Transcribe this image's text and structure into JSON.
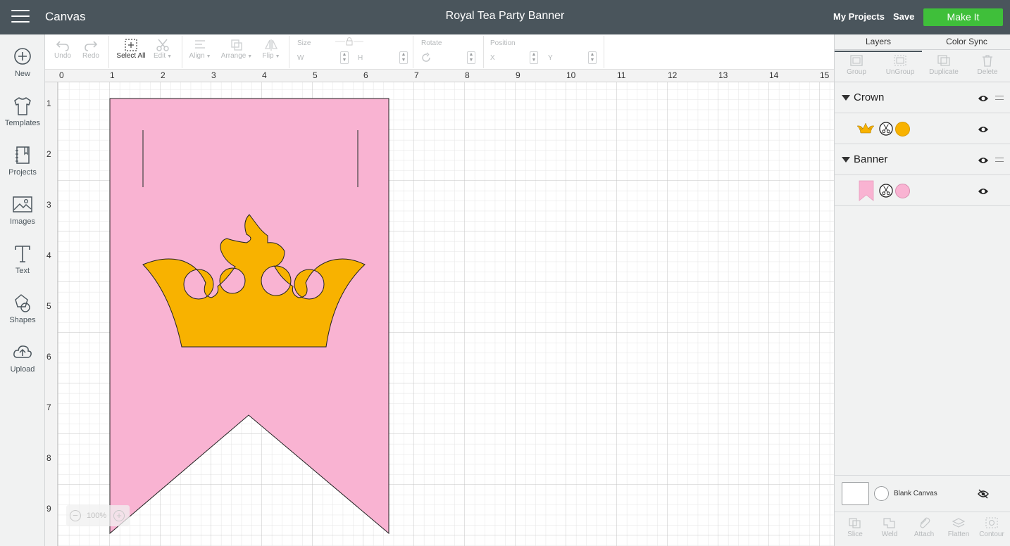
{
  "header": {
    "app_title": "Canvas",
    "doc_title": "Royal Tea Party Banner",
    "my_projects": "My Projects",
    "save": "Save",
    "make_it": "Make It",
    "make_it_color": "#3fbf3a",
    "bar_color": "#4a555c"
  },
  "sidebar": {
    "items": [
      {
        "label": "New",
        "icon": "plus-circle-icon"
      },
      {
        "label": "Templates",
        "icon": "tshirt-icon"
      },
      {
        "label": "Projects",
        "icon": "notebook-icon"
      },
      {
        "label": "Images",
        "icon": "image-icon"
      },
      {
        "label": "Text",
        "icon": "text-icon"
      },
      {
        "label": "Shapes",
        "icon": "shapes-icon"
      },
      {
        "label": "Upload",
        "icon": "cloud-upload-icon"
      }
    ]
  },
  "toolbar": {
    "undo": "Undo",
    "redo": "Redo",
    "select_all": "Select All",
    "edit": "Edit",
    "align": "Align",
    "arrange": "Arrange",
    "flip": "Flip",
    "size": "Size",
    "w": "W",
    "h": "H",
    "rotate": "Rotate",
    "position": "Position",
    "x": "X",
    "y": "Y"
  },
  "ruler": {
    "top": [
      "0",
      "1",
      "2",
      "3",
      "4",
      "5",
      "6",
      "7",
      "8",
      "9",
      "10",
      "11",
      "12",
      "13",
      "14",
      "15"
    ],
    "left": [
      "1",
      "2",
      "3",
      "4",
      "5",
      "6",
      "7",
      "8",
      "9"
    ]
  },
  "zoom": {
    "minus": "−",
    "value": "100%",
    "plus": "+"
  },
  "panel": {
    "tabs": [
      "Layers",
      "Color Sync"
    ],
    "actions": [
      "Group",
      "UnGroup",
      "Duplicate",
      "Delete"
    ],
    "groups": [
      {
        "name": "Crown",
        "color": "#f8b200",
        "icon": "crown-thumbnail-icon"
      },
      {
        "name": "Banner",
        "color": "#f9b3d2",
        "icon": "banner-thumbnail-icon"
      }
    ],
    "blank_canvas": "Blank Canvas",
    "bottom_actions": [
      "Slice",
      "Weld",
      "Attach",
      "Flatten",
      "Contour"
    ]
  },
  "design": {
    "banner_color": "#f9b3d2",
    "crown_color": "#f8b200"
  }
}
